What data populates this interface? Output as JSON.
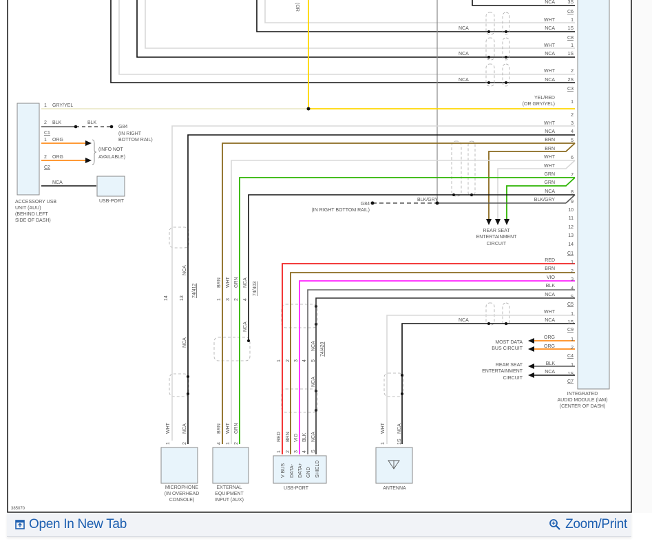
{
  "diagram": {
    "figure_id": "385070",
    "iam": {
      "name_lines": [
        "INTEGRATED",
        "AUDIO MODULE (IAM)",
        "(CENTER OF DASH)"
      ],
      "connectors": [
        "C6",
        "C8",
        "C3",
        "C1",
        "C5",
        "C9",
        "C4",
        "C7"
      ],
      "top_rows": [
        {
          "color": "NCA",
          "pin": "3S"
        },
        {
          "color": "WHT",
          "pin": "1"
        },
        {
          "color": "NCA",
          "pin": "1S",
          "left": "NCA"
        },
        {
          "color": "WHT",
          "pin": "1"
        },
        {
          "color": "NCA",
          "pin": "1S",
          "left": "NCA"
        },
        {
          "color": "WHT",
          "pin": "2"
        },
        {
          "color": "NCA",
          "pin": "2S",
          "left": "NCA"
        }
      ],
      "c3_rows": [
        {
          "color": "YEL/RED",
          "color2": "(OR GRY/YEL)",
          "pin": "1"
        },
        {
          "pin": "2"
        },
        {
          "color": "WHT",
          "pin": "3"
        },
        {
          "color": "NCA",
          "pin": "4"
        },
        {
          "color": "BRN",
          "pin": "5"
        },
        {
          "color": "BRN"
        },
        {
          "color": "WHT",
          "pin": "6"
        },
        {
          "color": "WHT"
        },
        {
          "color": "GRN",
          "pin": "7"
        },
        {
          "color": "GRN"
        },
        {
          "color": "NCA",
          "pin": "8"
        },
        {
          "color": "BLK/GRY",
          "pin": "9"
        },
        {
          "pin": "10"
        },
        {
          "pin": "11"
        },
        {
          "pin": "12"
        },
        {
          "pin": "13"
        },
        {
          "pin": "14"
        }
      ],
      "c1_rows": [
        {
          "color": "RED",
          "pin": "1"
        },
        {
          "color": "BRN",
          "pin": "2"
        },
        {
          "color": "VIO",
          "pin": "3"
        },
        {
          "color": "BLK",
          "pin": "4"
        },
        {
          "color": "NCA",
          "pin": "S"
        }
      ],
      "c5_rows": [
        {
          "color": "WHT",
          "pin": "1"
        },
        {
          "color": "NCA",
          "pin": "1S",
          "left": "NCA"
        }
      ],
      "c9_rows": [
        {
          "color": "ORG",
          "pin": "1"
        },
        {
          "color": "ORG",
          "pin": "2"
        }
      ],
      "c4_rows": [
        {
          "color": "BLK",
          "pin": "1"
        },
        {
          "color": "NCA",
          "pin": "1S"
        }
      ]
    },
    "top_fragment": "(OR",
    "rear_seat_circuit": [
      "REAR SEAT",
      "ENTERTAINMENT",
      "CIRCUIT"
    ],
    "most_bus": [
      "MOST DATA",
      "BUS CIRCUIT"
    ],
    "rear_seat_circuit_2": [
      "REAR SEAT",
      "ENTERTAINMENT",
      "CIRCUIT"
    ],
    "ground_g84_right": {
      "wire": "BLK/GRY",
      "name": "G84",
      "location": "(IN RIGHT BOTTOM RAIL)"
    },
    "auu": {
      "name_lines": [
        "ACCESSORY USB",
        "UNIT (AUU)",
        "(BEHIND LEFT",
        "SIDE OF DASH)"
      ],
      "rows": [
        {
          "pin": "1",
          "color": "GRY/YEL"
        },
        {
          "pin": "2",
          "color": "BLK",
          "color2": "BLK"
        },
        {
          "pin": "1",
          "color": "ORG"
        },
        {
          "pin": "2",
          "color": "ORG"
        },
        {
          "color": "NCA"
        }
      ],
      "connectors": [
        "C1",
        "C2"
      ],
      "ground": {
        "name": "G84",
        "location_lines": [
          "(IN RIGHT",
          "BOTTOM RAIL)"
        ]
      },
      "info_lines": [
        "(INFO NOT",
        "AVAILABLE)"
      ],
      "usb_port": "USB-PORT"
    },
    "inline_connectors": [
      {
        "name": "74/412",
        "pins": [
          "14",
          "13"
        ],
        "colors": [
          "NCA",
          "NCA"
        ]
      },
      {
        "name": "74/403",
        "pins": [
          "1",
          "3",
          "2",
          "4"
        ],
        "colors": [
          "BRN",
          "WHT",
          "GRN",
          "NCA"
        ],
        "below": "NCA"
      },
      {
        "name": "74/420",
        "pins": [
          "1",
          "2",
          "3",
          "4",
          "5"
        ],
        "colors": [
          "NCA"
        ],
        "below": "NCA"
      }
    ],
    "components": {
      "microphone": {
        "name_lines": [
          "MICROPHONE",
          "(IN OVERHEAD",
          "CONSOLE)"
        ],
        "pins": [
          "1",
          "2"
        ],
        "colors": [
          "WHT",
          "NCA"
        ]
      },
      "aux": {
        "name_lines": [
          "EXTERNAL",
          "EQUIPMENT",
          "INPUT (AUX)"
        ],
        "pins": [
          "4",
          "1",
          "2"
        ],
        "colors": [
          "BRN",
          "WHT",
          "GRN"
        ]
      },
      "usb_port": {
        "name": "USB-PORT",
        "pins": [
          "1",
          "2",
          "3",
          "4",
          "S"
        ],
        "colors": [
          "RED",
          "BRN",
          "VIO",
          "BLK",
          "NCA"
        ],
        "terminals": [
          "V BUS",
          "DATA-",
          "DATA+",
          "GND",
          "SHIELD"
        ]
      },
      "antenna": {
        "name": "ANTENNA",
        "pins": [
          "1",
          "1S"
        ],
        "colors": [
          "WHT",
          "NCA"
        ]
      }
    }
  },
  "footer": {
    "open_new_tab": "Open In New Tab",
    "zoom_print": "Zoom/Print",
    "link_color": "#1d5fb0"
  }
}
